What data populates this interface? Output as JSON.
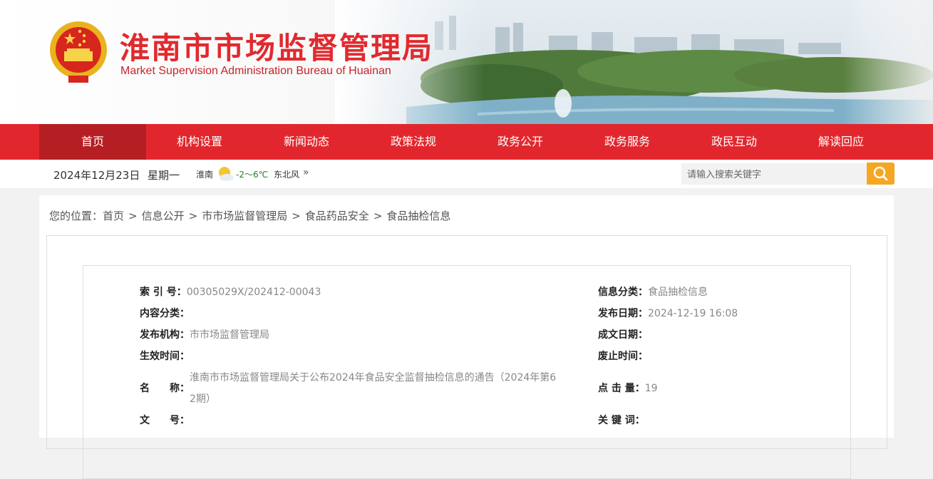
{
  "header": {
    "title": "淮南市市场监督管理局",
    "subtitle": "Market Supervision Administration Bureau of Huainan"
  },
  "nav": {
    "items": [
      {
        "label": "首页",
        "active": true
      },
      {
        "label": "机构设置"
      },
      {
        "label": "新闻动态"
      },
      {
        "label": "政策法规"
      },
      {
        "label": "政务公开"
      },
      {
        "label": "政务服务"
      },
      {
        "label": "政民互动"
      },
      {
        "label": "解读回应"
      }
    ]
  },
  "infobar": {
    "date": "2024年12月23日",
    "weekday": "星期一",
    "city": "淮南",
    "temperature": "-2～6℃",
    "wind": "东北风",
    "more": "»",
    "search_placeholder": "请输入搜索关键字"
  },
  "breadcrumb": {
    "prefix": "您的位置：",
    "items": [
      "首页",
      "信息公开",
      "市市场监督管理局",
      "食品药品安全",
      "食品抽检信息"
    ],
    "separator": ">"
  },
  "meta": {
    "left": [
      {
        "label": "索 引 号：",
        "value": "00305029X/202412-00043"
      },
      {
        "label": "内容分类：",
        "value": ""
      },
      {
        "label": "发布机构：",
        "value": "市市场监督管理局"
      },
      {
        "label": "生效时间：",
        "value": ""
      },
      {
        "label": "名　　称：",
        "value_line1": "淮南市市场监督管理局关于公布2024年食品安全监督抽检信息的通告（2024年第6",
        "value_line2": "2期）"
      },
      {
        "label": "文　　号：",
        "value": ""
      }
    ],
    "right": [
      {
        "label": "信息分类：",
        "value": "食品抽检信息"
      },
      {
        "label": "发布日期：",
        "value": "2024-12-19 16:08"
      },
      {
        "label": "成文日期：",
        "value": ""
      },
      {
        "label": "废止时间：",
        "value": ""
      },
      {
        "label": "点 击 量：",
        "value": "19"
      },
      {
        "label": "关 键 词：",
        "value": ""
      }
    ]
  },
  "colors": {
    "brand_red": "#e1272d",
    "nav_active": "#b51f24",
    "search_button": "#f5a623"
  }
}
